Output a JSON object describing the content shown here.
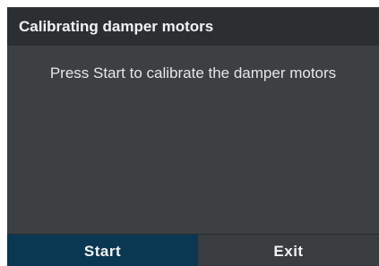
{
  "dialog": {
    "title": "Calibrating damper motors",
    "message": "Press Start to calibrate the damper motors",
    "buttons": {
      "start_label": "Start",
      "exit_label": "Exit"
    }
  },
  "colors": {
    "body_background": "#3c4043",
    "title_background": "#2c2f31",
    "primary_button_background": "#0a3752",
    "secondary_button_background": "#3a3d40",
    "text": "#f2f2f2"
  }
}
